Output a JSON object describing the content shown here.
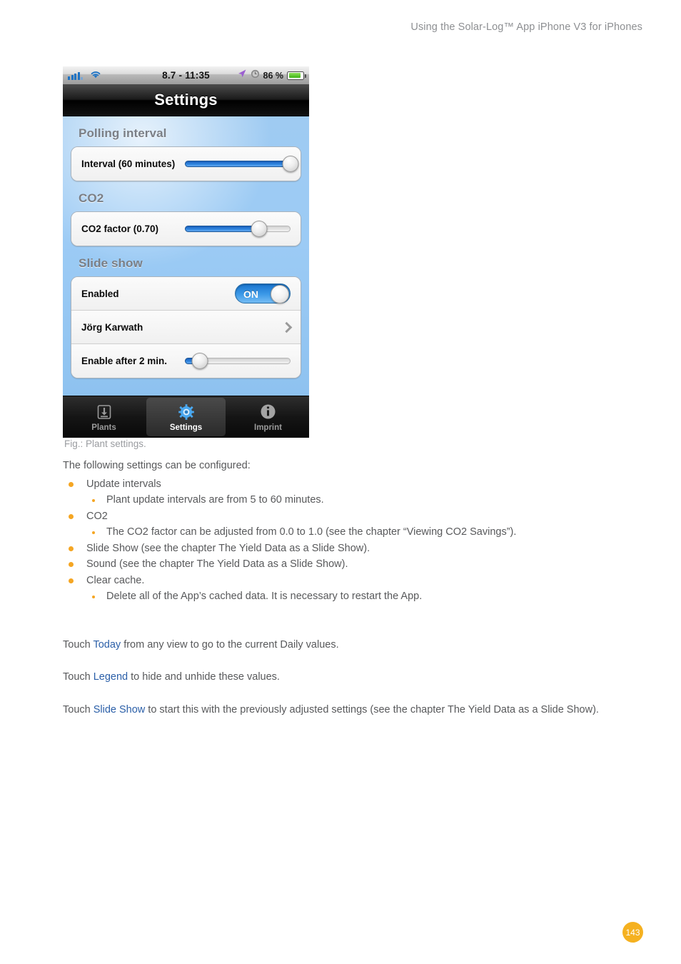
{
  "page_header": "Using the Solar-Log™ App iPhone V3 for iPhones",
  "page_number": "143",
  "screenshot": {
    "statusbar": {
      "signal_icon": "signal-bars-icon",
      "wifi_icon": "wifi-icon",
      "time": "8.7 - 11:35",
      "location_icon": "location-arrow-icon",
      "alarm_icon": "alarm-clock-icon",
      "battery_percent": "86 %",
      "battery_icon": "battery-icon"
    },
    "navbar": {
      "title": "Settings"
    },
    "sections": [
      {
        "title": "Polling interval",
        "rows": [
          {
            "type": "slider",
            "label": "Interval (60 minutes)",
            "value": 100
          }
        ]
      },
      {
        "title": "CO2",
        "rows": [
          {
            "type": "slider",
            "label": "CO2 factor (0.70)",
            "value": 70
          }
        ]
      },
      {
        "title": "Slide show",
        "rows": [
          {
            "type": "toggle",
            "label": "Enabled",
            "state": "ON"
          },
          {
            "type": "disclosure",
            "label": "Jörg Karwath",
            "icon": "chevron-right-icon"
          },
          {
            "type": "slider",
            "label": "Enable after 2 min.",
            "value": 14
          }
        ]
      }
    ],
    "tabbar": [
      {
        "label": "Plants",
        "icon": "download-tray-icon",
        "active": false
      },
      {
        "label": "Settings",
        "icon": "gear-icon",
        "active": true
      },
      {
        "label": "Imprint",
        "icon": "info-circle-icon",
        "active": false
      }
    ]
  },
  "fig_caption": "Fig.: Plant settings.",
  "body": {
    "intro": "The following settings can be configured:",
    "bullets": [
      {
        "text": "Update intervals",
        "sub": [
          "Plant update intervals are from 5 to 60 minutes."
        ]
      },
      {
        "text": "CO2",
        "sub": [
          "The CO2 factor can be adjusted from 0.0 to 1.0 (see the chapter “Viewing CO2 Savings”)."
        ]
      },
      {
        "text": "Slide Show (see the chapter The Yield Data as a Slide Show).",
        "sub": []
      },
      {
        "text": "Sound (see the chapter The Yield Data as a Slide Show).",
        "sub": []
      },
      {
        "text": "Clear cache.",
        "sub": [
          "Delete all of the App’s cached data. It is necessary to restart the App."
        ]
      }
    ],
    "paragraphs": [
      {
        "pre": "Touch ",
        "link": "Today",
        "post": " from any view to go to the current Daily values."
      },
      {
        "pre": "Touch ",
        "link": "Legend",
        "post": " to hide and unhide these values."
      },
      {
        "pre": "Touch ",
        "link": "Slide Show",
        "post": " to start this with the previously adjusted settings (see the chapter The Yield Data as a Slide Show)."
      }
    ]
  },
  "colors": {
    "accent_orange": "#f5a623",
    "link_blue": "#2b5fa8",
    "badge_orange": "#f5b120",
    "toggle_blue": "#3d9ae8"
  }
}
